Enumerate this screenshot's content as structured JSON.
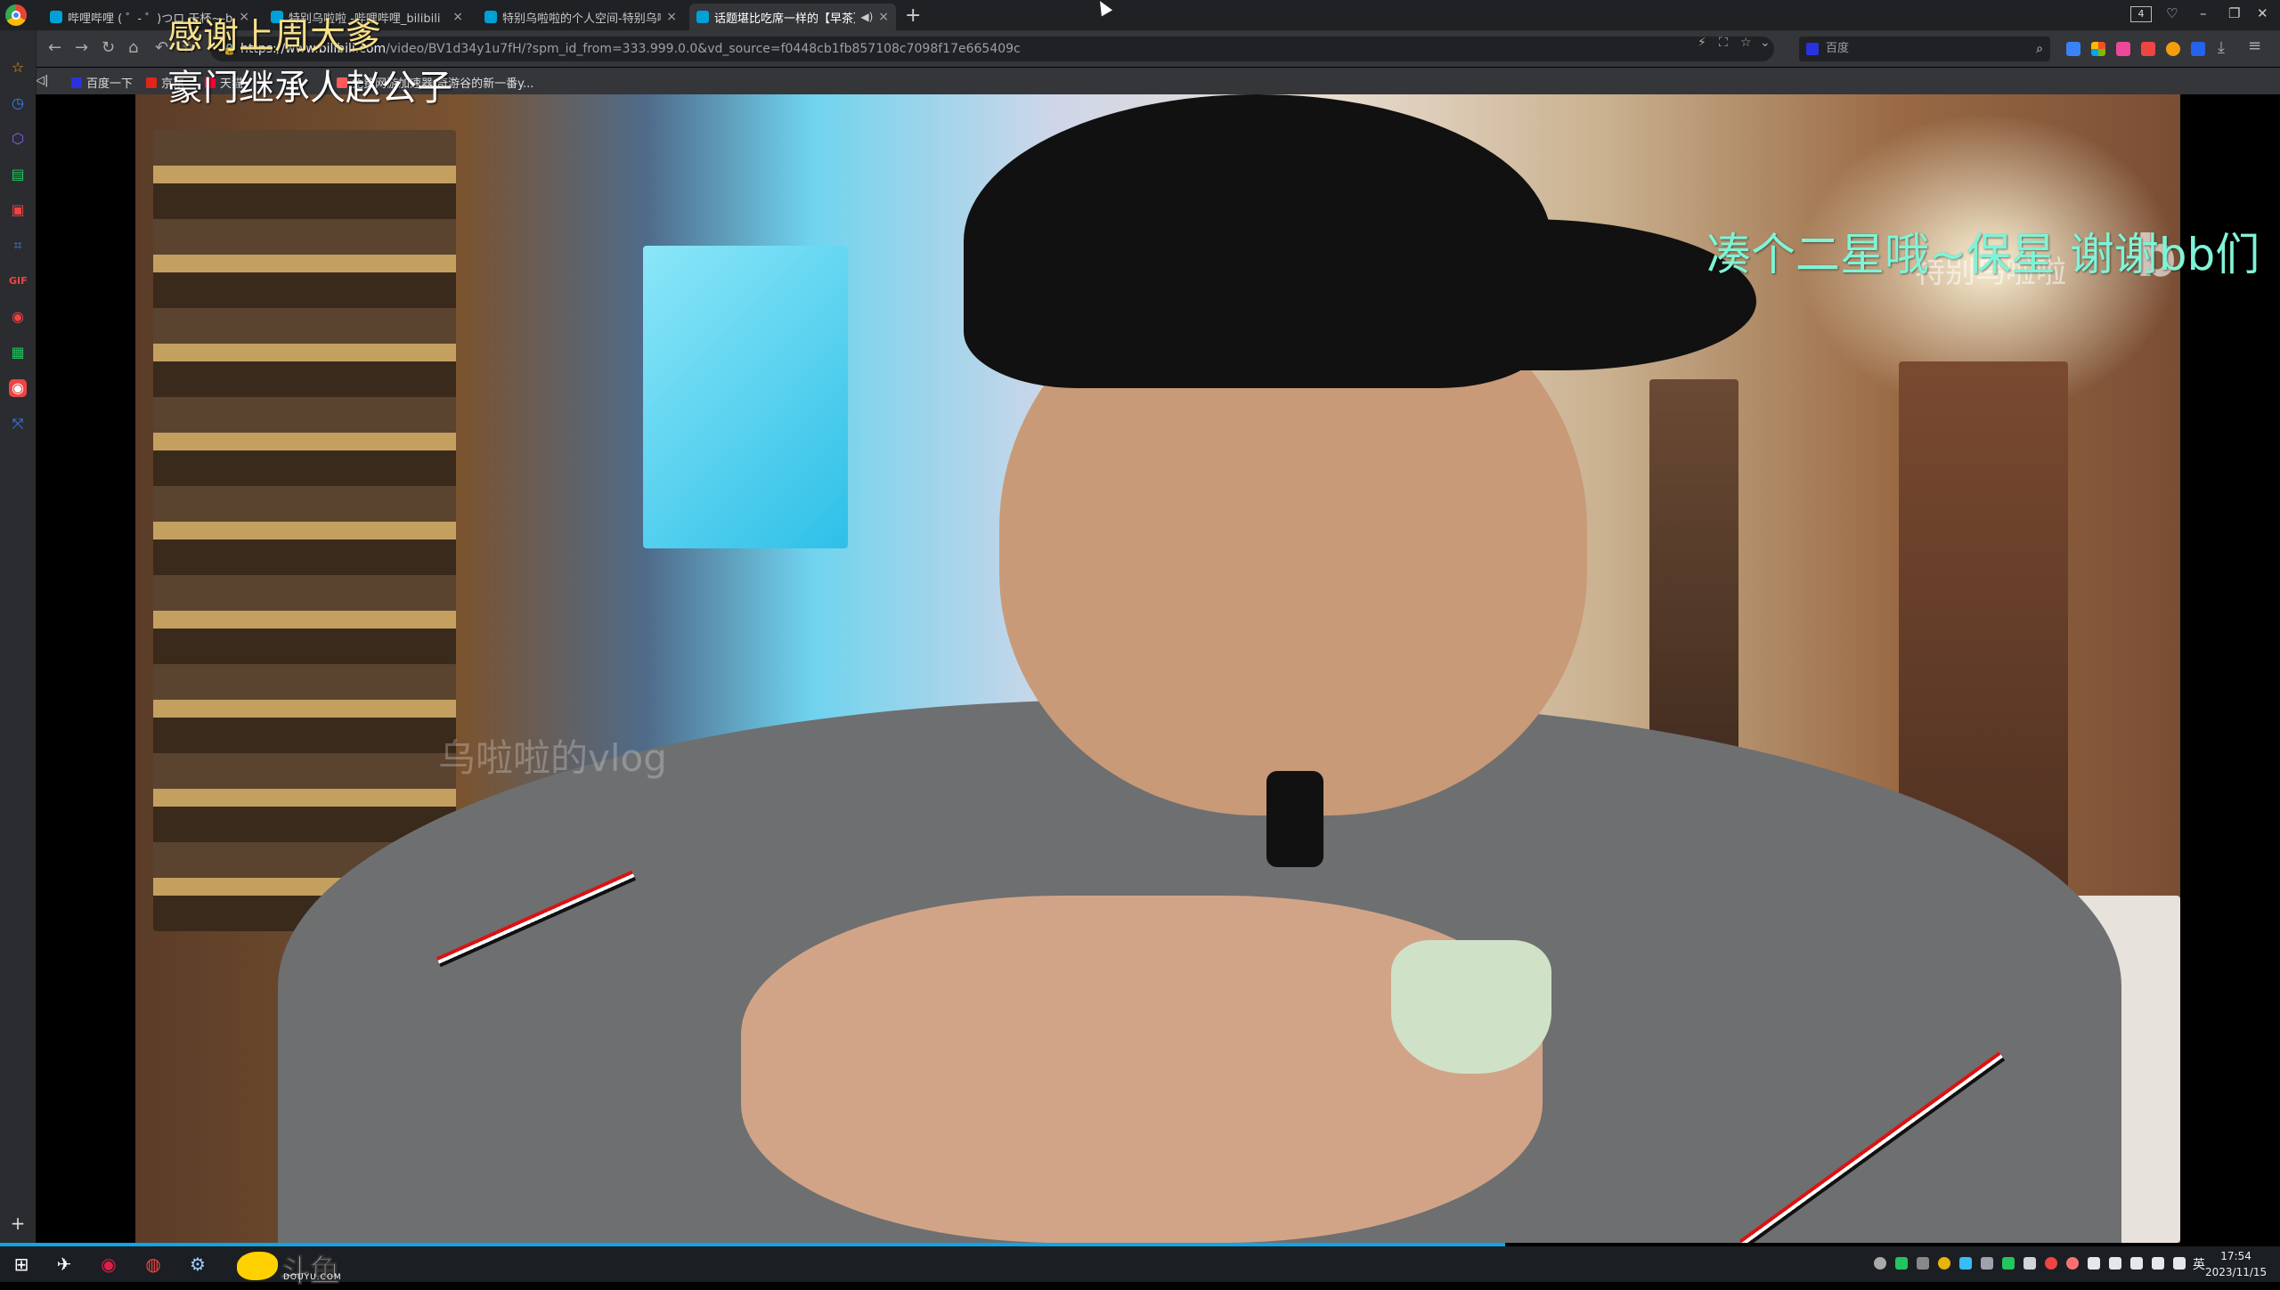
{
  "browser": {
    "tabs": [
      {
        "title": "哔哩哔哩 ( ゜- ゜)つロ 干杯~-bilibili",
        "active": false
      },
      {
        "title": "特别乌啦啦 -哔哩哔哩_bilibili",
        "active": false
      },
      {
        "title": "特别乌啦啦的个人空间-特别乌啦啦",
        "active": false
      },
      {
        "title": "话题堪比吃席一样的【早茶】",
        "active": true
      }
    ],
    "tab_count": "4",
    "url_host": "https://www.bilibili.com",
    "url_path": "/video/BV1d34y1u7fH/?spm_id_from=333.999.0.0&vd_source=f0448cb1fb857108c7098f17e665409c",
    "search_placeholder": "百度",
    "bookmarks": [
      {
        "label": "百度一下",
        "color": "#2932e1"
      },
      {
        "label": "京东",
        "color": "#e1251b"
      },
      {
        "label": "天猫",
        "color": "#ff0036"
      },
      {
        "label": "免费网游加速器 奇游谷的新一番y...",
        "color": "#ff5a5a"
      }
    ]
  },
  "overlay": {
    "gift_thanks": "感谢上周大爹",
    "gift_user": "豪门继承人赵公子",
    "scroll_danmaku": "凑个二星哦~保星 谢谢bb们",
    "channel_watermark": "特别乌啦啦",
    "bili_watermark": "bilibili",
    "video_watermark": "乌啦啦的vlog"
  },
  "stream": {
    "platform_name": "斗鱼",
    "platform_domain": "DOUYU.COM",
    "accent_color": "#0ea5e9"
  },
  "taskbar": {
    "time": "17:54",
    "date": "2023/11/15",
    "ime": "英"
  }
}
